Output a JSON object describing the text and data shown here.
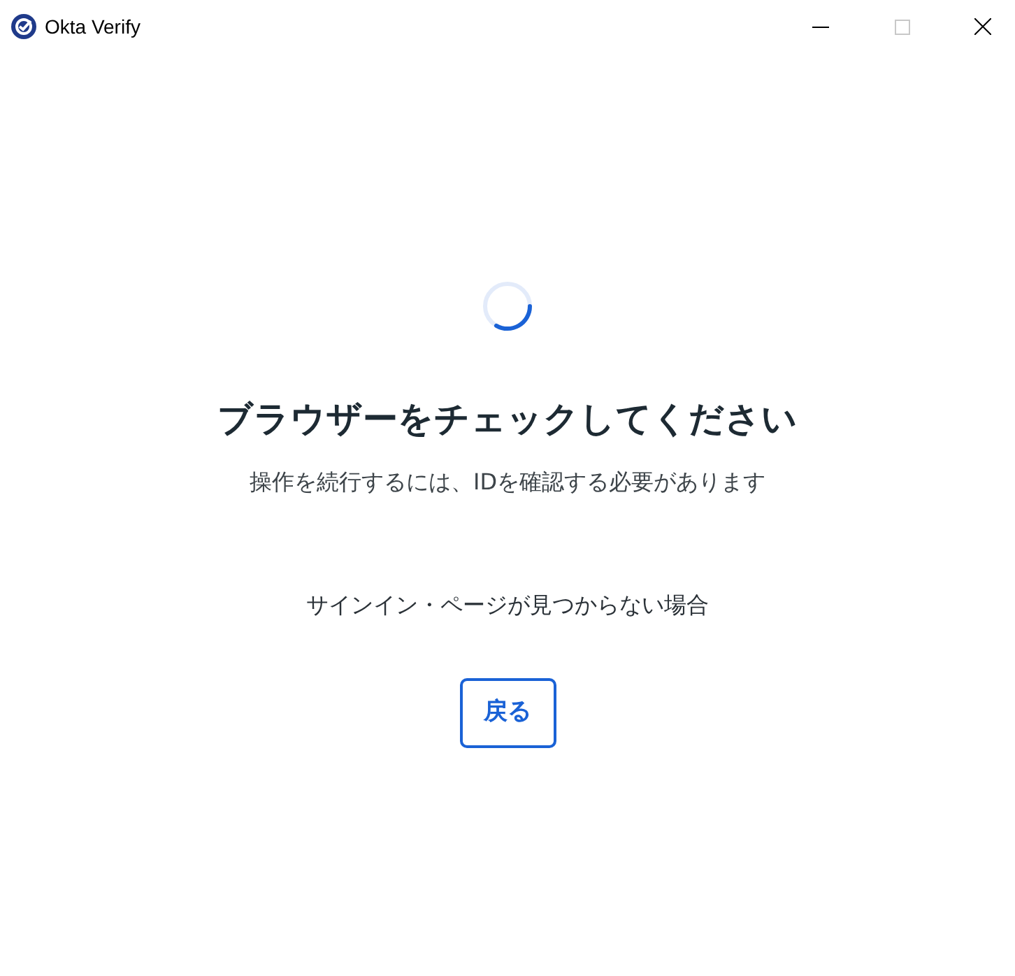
{
  "window": {
    "title": "Okta Verify"
  },
  "heading": "ブラウザーをチェックしてください",
  "message": "操作を続行するには、IDを確認する必要があります",
  "help_link": "サインイン・ページが見つからない場合",
  "back_button": "戻る"
}
